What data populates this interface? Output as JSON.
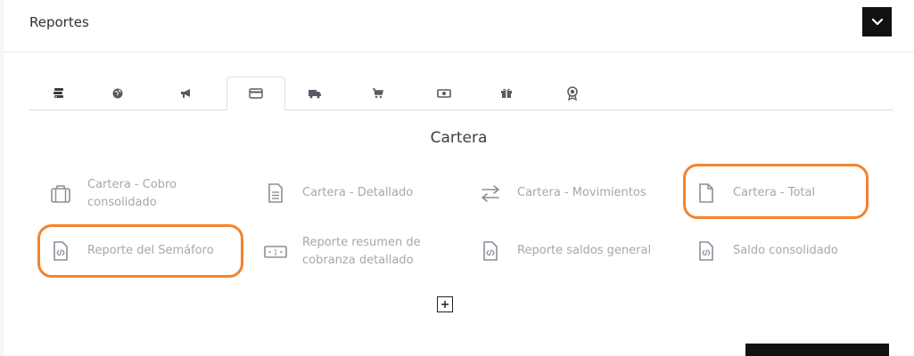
{
  "header": {
    "title": "Reportes"
  },
  "tabs": [
    {
      "icon": "money-stack-icon"
    },
    {
      "icon": "globe-icon"
    },
    {
      "icon": "megaphone-icon"
    },
    {
      "icon": "credit-card-icon",
      "active": true
    },
    {
      "icon": "truck-icon"
    },
    {
      "icon": "cart-icon"
    },
    {
      "icon": "banknote-icon"
    },
    {
      "icon": "gift-icon"
    },
    {
      "icon": "award-icon"
    }
  ],
  "section": {
    "title": "Cartera"
  },
  "reports": [
    {
      "label": "Cartera - Cobro consolidado",
      "icon": "briefcase-icon"
    },
    {
      "label": "Cartera - Detallado",
      "icon": "document-lines-icon"
    },
    {
      "label": "Cartera - Movimientos",
      "icon": "exchange-arrows-icon"
    },
    {
      "label": "Cartera - Total",
      "icon": "document-icon"
    },
    {
      "label": "Reporte del Semáforo",
      "icon": "file-code-icon"
    },
    {
      "label": "Reporte resumen de cobranza detallado",
      "icon": "banknote-icon"
    },
    {
      "label": "Reporte saldos general",
      "icon": "file-code-icon"
    },
    {
      "label": "Saldo consolidado",
      "icon": "file-code-icon"
    }
  ],
  "colors": {
    "highlight": "#f5822a",
    "accent": "#111111",
    "label": "#a6a6b2"
  },
  "bottom_button": {
    "label": "…"
  }
}
